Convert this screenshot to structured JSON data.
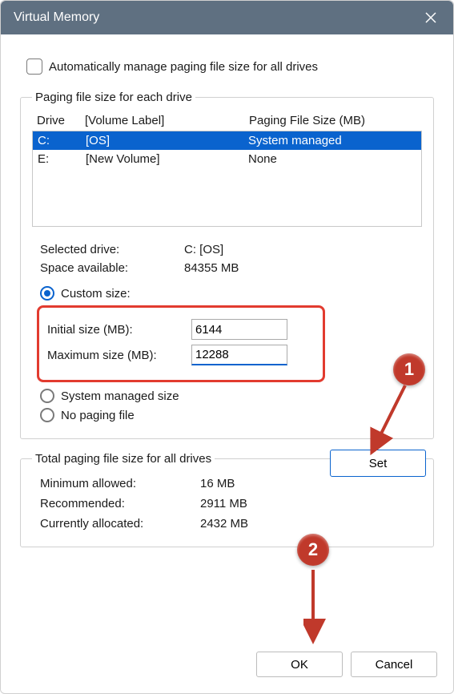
{
  "window": {
    "title": "Virtual Memory"
  },
  "auto_checkbox": {
    "label": "Automatically manage paging file size for all drives",
    "checked": false
  },
  "group1": {
    "legend": "Paging file size for each drive",
    "headers": {
      "drive": "Drive",
      "vol": "[Volume Label]",
      "pfs": "Paging File Size (MB)"
    },
    "rows": [
      {
        "drive": "C:",
        "vol": "[OS]",
        "pfs": "System managed",
        "selected": true
      },
      {
        "drive": "E:",
        "vol": "[New Volume]",
        "pfs": "None",
        "selected": false
      }
    ],
    "selected_label": "Selected drive:",
    "selected_value": "C:  [OS]",
    "space_label": "Space available:",
    "space_value": "84355 MB",
    "radios": {
      "custom_label": "Custom size:",
      "initial_label": "Initial size (MB):",
      "initial_value": "6144",
      "max_label": "Maximum size (MB):",
      "max_value": "12288",
      "sysmanaged_label": "System managed size",
      "nopaging_label": "No paging file"
    },
    "set_button": "Set"
  },
  "group2": {
    "legend": "Total paging file size for all drives",
    "min_label": "Minimum allowed:",
    "min_value": "16 MB",
    "rec_label": "Recommended:",
    "rec_value": "2911 MB",
    "cur_label": "Currently allocated:",
    "cur_value": "2432 MB"
  },
  "buttons": {
    "ok": "OK",
    "cancel": "Cancel"
  },
  "callouts": {
    "one": "1",
    "two": "2"
  }
}
